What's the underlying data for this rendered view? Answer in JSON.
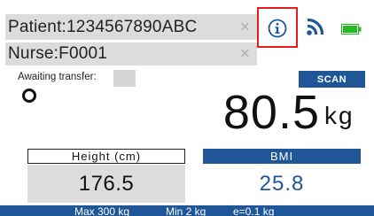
{
  "patient_field": {
    "value": "Patient:1234567890ABC",
    "clear_label": "×"
  },
  "nurse_field": {
    "value": "Nurse:F0001",
    "clear_label": "×"
  },
  "status_icons": {
    "info": "info-icon",
    "signal": "wifi-icon",
    "battery": "battery-icon",
    "info_highlight_color": "#e31c1c",
    "signal_color": "#1e5697",
    "battery_color": "#22bb22",
    "battery_level": 1.0
  },
  "transfer": {
    "label": "Awaiting transfer:",
    "value": ""
  },
  "scan": {
    "label": "SCAN"
  },
  "weight": {
    "value": "80.5",
    "unit": "kg"
  },
  "height": {
    "label": "Height (cm)",
    "value": "176.5"
  },
  "bmi": {
    "label": "BMI",
    "value": "25.8"
  },
  "footer": {
    "max": "Max 300 kg",
    "min": "Min 2 kg",
    "resolution": "e=0.1 kg"
  },
  "colors": {
    "accent": "#1e5697",
    "field_bg": "#dcdcdc",
    "text": "#111111"
  }
}
